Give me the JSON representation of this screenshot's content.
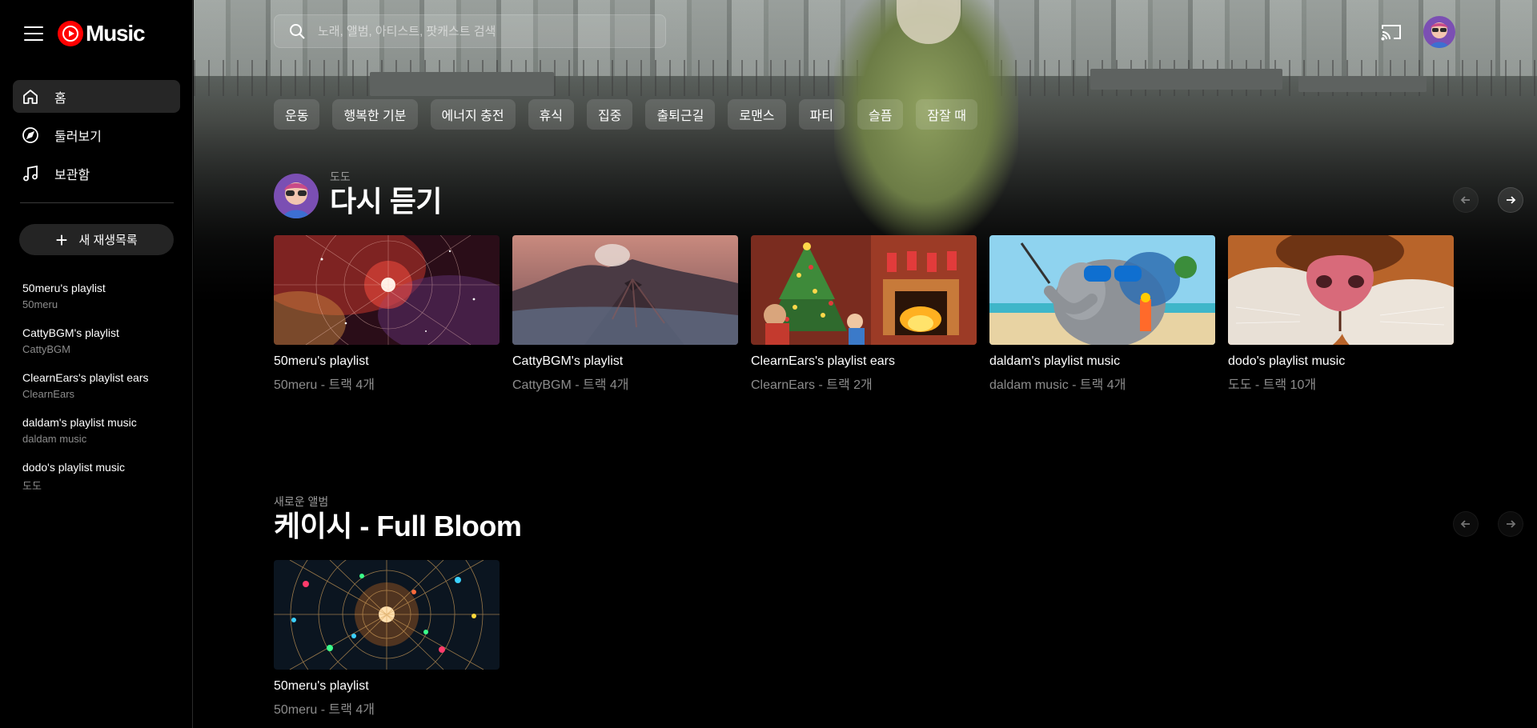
{
  "app": {
    "logo_text": "Music",
    "brand_color": "#ff0000"
  },
  "sidebar": {
    "nav": [
      {
        "label": "홈",
        "icon": "home-icon",
        "active": true
      },
      {
        "label": "둘러보기",
        "icon": "compass-icon",
        "active": false
      },
      {
        "label": "보관함",
        "icon": "music-note-icon",
        "active": false
      }
    ],
    "new_playlist_label": "새 재생목록",
    "playlists": [
      {
        "title": "50meru's playlist",
        "owner": "50meru"
      },
      {
        "title": "CattyBGM's playlist",
        "owner": "CattyBGM"
      },
      {
        "title": "ClearnEars's playlist ears",
        "owner": "ClearnEars"
      },
      {
        "title": "daldam's playlist music",
        "owner": "daldam music"
      },
      {
        "title": "dodo's playlist music",
        "owner": "도도"
      }
    ]
  },
  "search": {
    "placeholder": "노래, 앨범, 아티스트, 팟캐스트 검색"
  },
  "chips": [
    "운동",
    "행복한 기분",
    "에너지 충전",
    "휴식",
    "집중",
    "출퇴근길",
    "로맨스",
    "파티",
    "슬픔",
    "잠잘 때"
  ],
  "section1": {
    "sup": "도도",
    "title": "다시 듣기",
    "cards": [
      {
        "title": "50meru's playlist",
        "subtitle": "50meru - 트랙 4개",
        "art": "nebula"
      },
      {
        "title": "CattyBGM's playlist",
        "subtitle": "CattyBGM - 트랙 4개",
        "art": "volcano"
      },
      {
        "title": "ClearnEars's playlist ears",
        "subtitle": "ClearnEars - 트랙 2개",
        "art": "christmas"
      },
      {
        "title": "daldam's playlist music",
        "subtitle": "daldam music - 트랙 4개",
        "art": "elephant"
      },
      {
        "title": "dodo's playlist music",
        "subtitle": "도도 - 트랙 10개",
        "art": "cat-nose"
      }
    ]
  },
  "section2": {
    "sup": "새로운 앨범",
    "title": "케이시 - Full Bloom",
    "cards": [
      {
        "title": "50meru's playlist",
        "subtitle": "50meru - 트랙 4개",
        "art": "constellation"
      }
    ]
  }
}
